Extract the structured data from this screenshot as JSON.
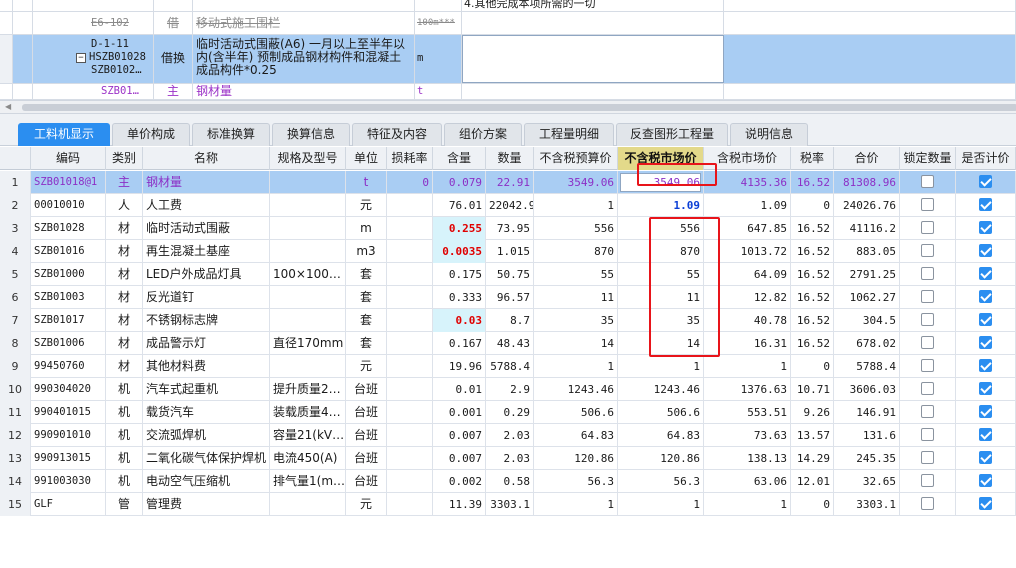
{
  "top_grid": {
    "row0": {
      "note": "4.其他完成本项所需的一切"
    },
    "row1": {
      "code": "E6-102",
      "type": "借",
      "name": "移动式施工围栏",
      "unit": "100m***"
    },
    "row2": {
      "code": [
        "D-1-11",
        "HSZB01028",
        "SZB0102…"
      ],
      "type": "借换",
      "name": [
        "临时活动式围蔽(A6)  一月以上至半年以",
        "内(含半年) 预制成品钢材构件和混凝土",
        "成品构件*0.25"
      ],
      "unit": "m",
      "collapse": "−"
    },
    "row3": {
      "code": "SZB01…",
      "type": "主",
      "name": "钢材量",
      "unit": "t"
    }
  },
  "tabs": [
    "工料机显示",
    "单价构成",
    "标准换算",
    "换算信息",
    "特征及内容",
    "组价方案",
    "工程量明细",
    "反查图形工程量",
    "说明信息"
  ],
  "headers": [
    "编码",
    "类别",
    "名称",
    "规格及型号",
    "单位",
    "损耗率",
    "含量",
    "数量",
    "不含税预算价",
    "不含税市场价",
    "含税市场价",
    "税率",
    "合价",
    "锁定数量",
    "是否计价"
  ],
  "rows": [
    {
      "no": "1",
      "code": "SZB01018@1",
      "cat": "主",
      "name": "钢材量",
      "spec": "",
      "unit": "t",
      "loss": "0",
      "content": "0.079",
      "qty": "22.91",
      "budget": "3549.06",
      "market": "3549.06",
      "tax_market": "4135.36",
      "rate": "16.52",
      "total": "81308.96",
      "locked": false,
      "priced": true
    },
    {
      "no": "2",
      "code": "00010010",
      "cat": "人",
      "name": "人工费",
      "spec": "",
      "unit": "元",
      "loss": "",
      "content": "76.01",
      "qty": "22042.9",
      "budget": "1",
      "market": "1.09",
      "tax_market": "1.09",
      "rate": "0",
      "total": "24026.76",
      "locked": false,
      "priced": true
    },
    {
      "no": "3",
      "code": "SZB01028",
      "cat": "材",
      "name": "临时活动式围蔽",
      "spec": "",
      "unit": "m",
      "loss": "",
      "content": "0.255",
      "qty": "73.95",
      "budget": "556",
      "market": "556",
      "tax_market": "647.85",
      "rate": "16.52",
      "total": "41116.2",
      "locked": false,
      "priced": true
    },
    {
      "no": "4",
      "code": "SZB01016",
      "cat": "材",
      "name": "再生混凝土基座",
      "spec": "",
      "unit": "m3",
      "loss": "",
      "content": "0.0035",
      "qty": "1.015",
      "budget": "870",
      "market": "870",
      "tax_market": "1013.72",
      "rate": "16.52",
      "total": "883.05",
      "locked": false,
      "priced": true
    },
    {
      "no": "5",
      "code": "SZB01000",
      "cat": "材",
      "name": "LED户外成品灯具",
      "spec": "100×100…",
      "unit": "套",
      "loss": "",
      "content": "0.175",
      "qty": "50.75",
      "budget": "55",
      "market": "55",
      "tax_market": "64.09",
      "rate": "16.52",
      "total": "2791.25",
      "locked": false,
      "priced": true
    },
    {
      "no": "6",
      "code": "SZB01003",
      "cat": "材",
      "name": "反光道钉",
      "spec": "",
      "unit": "套",
      "loss": "",
      "content": "0.333",
      "qty": "96.57",
      "budget": "11",
      "market": "11",
      "tax_market": "12.82",
      "rate": "16.52",
      "total": "1062.27",
      "locked": false,
      "priced": true
    },
    {
      "no": "7",
      "code": "SZB01017",
      "cat": "材",
      "name": "不锈钢标志牌",
      "spec": "",
      "unit": "套",
      "loss": "",
      "content": "0.03",
      "qty": "8.7",
      "budget": "35",
      "market": "35",
      "tax_market": "40.78",
      "rate": "16.52",
      "total": "304.5",
      "locked": false,
      "priced": true
    },
    {
      "no": "8",
      "code": "SZB01006",
      "cat": "材",
      "name": "成品警示灯",
      "spec": "直径170mm",
      "unit": "套",
      "loss": "",
      "content": "0.167",
      "qty": "48.43",
      "budget": "14",
      "market": "14",
      "tax_market": "16.31",
      "rate": "16.52",
      "total": "678.02",
      "locked": false,
      "priced": true
    },
    {
      "no": "9",
      "code": "99450760",
      "cat": "材",
      "name": "其他材料费",
      "spec": "",
      "unit": "元",
      "loss": "",
      "content": "19.96",
      "qty": "5788.4",
      "budget": "1",
      "market": "1",
      "tax_market": "1",
      "rate": "0",
      "total": "5788.4",
      "locked": false,
      "priced": true
    },
    {
      "no": "10",
      "code": "990304020",
      "cat": "机",
      "name": "汽车式起重机",
      "spec": "提升质量2…",
      "unit": "台班",
      "loss": "",
      "content": "0.01",
      "qty": "2.9",
      "budget": "1243.46",
      "market": "1243.46",
      "tax_market": "1376.63",
      "rate": "10.71",
      "total": "3606.03",
      "locked": false,
      "priced": true
    },
    {
      "no": "11",
      "code": "990401015",
      "cat": "机",
      "name": "载货汽车",
      "spec": "装载质量4…",
      "unit": "台班",
      "loss": "",
      "content": "0.001",
      "qty": "0.29",
      "budget": "506.6",
      "market": "506.6",
      "tax_market": "553.51",
      "rate": "9.26",
      "total": "146.91",
      "locked": false,
      "priced": true
    },
    {
      "no": "12",
      "code": "990901010",
      "cat": "机",
      "name": "交流弧焊机",
      "spec": "容量21(kV…",
      "unit": "台班",
      "loss": "",
      "content": "0.007",
      "qty": "2.03",
      "budget": "64.83",
      "market": "64.83",
      "tax_market": "73.63",
      "rate": "13.57",
      "total": "131.6",
      "locked": false,
      "priced": true
    },
    {
      "no": "13",
      "code": "990913015",
      "cat": "机",
      "name": "二氧化碳气体保护焊机",
      "spec": "电流450(A)",
      "unit": "台班",
      "loss": "",
      "content": "0.007",
      "qty": "2.03",
      "budget": "120.86",
      "market": "120.86",
      "tax_market": "138.13",
      "rate": "14.29",
      "total": "245.35",
      "locked": false,
      "priced": true
    },
    {
      "no": "14",
      "code": "991003030",
      "cat": "机",
      "name": "电动空气压缩机",
      "spec": "排气量1(m…",
      "unit": "台班",
      "loss": "",
      "content": "0.002",
      "qty": "0.58",
      "budget": "56.3",
      "market": "56.3",
      "tax_market": "63.06",
      "rate": "12.01",
      "total": "32.65",
      "locked": false,
      "priced": true
    },
    {
      "no": "15",
      "code": "GLF",
      "cat": "管",
      "name": "管理费",
      "spec": "",
      "unit": "元",
      "loss": "",
      "content": "11.39",
      "qty": "3303.1",
      "budget": "1",
      "market": "1",
      "tax_market": "1",
      "rate": "0",
      "total": "3303.1",
      "locked": false,
      "priced": true
    }
  ],
  "colors": {
    "tab_active": "#2b8ef0",
    "selected_row": "#a9cdf3",
    "highlight_header": "#e3d98a",
    "annotation_red": "#e8141a"
  }
}
